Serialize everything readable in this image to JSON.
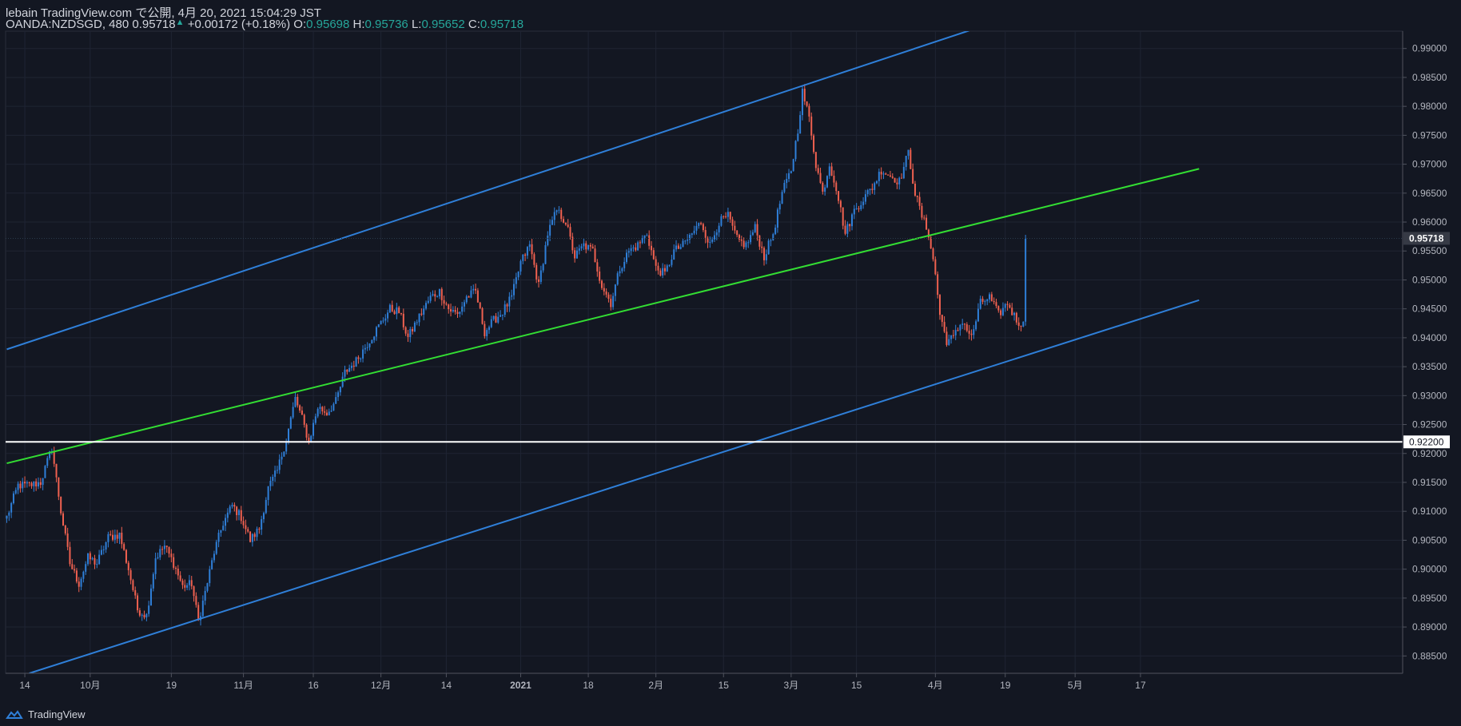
{
  "header": {
    "line1": "lebain TradingView.com で公開, 4月 20, 2021 15:04:29 JST",
    "symbol": "OANDA:NZDSGD, 480",
    "last": "0.95718",
    "change_arrow": "▲",
    "change": "+0.00172 (+0.18%)",
    "o_label": "O:",
    "o_value": "0.95698",
    "h_label": "H:",
    "h_value": "0.95736",
    "l_label": "L:",
    "l_value": "0.95652",
    "c_label": "C:",
    "c_value": "0.95718"
  },
  "footer": {
    "brand": "TradingView"
  },
  "colors": {
    "background": "#131722",
    "up": "#2f7fd8",
    "down": "#f06150",
    "channel": "#2f7fd8",
    "midline": "#33dd33",
    "hline": "#ffffff",
    "grid": "#1f2433"
  },
  "chart_data": {
    "type": "candlestick",
    "symbol": "OANDA:NZDSGD",
    "interval": "480",
    "ylim": [
      0.882,
      0.993
    ],
    "y_ticks": [
      "0.99000",
      "0.98500",
      "0.98000",
      "0.97500",
      "0.97000",
      "0.96500",
      "0.96000",
      "0.95500",
      "0.95000",
      "0.94500",
      "0.94000",
      "0.93500",
      "0.93000",
      "0.92500",
      "0.92000",
      "0.91500",
      "0.91000",
      "0.90500",
      "0.90000",
      "0.89500",
      "0.89000",
      "0.88500"
    ],
    "x_ticks": [
      {
        "label": "14",
        "date": "2020-09-14",
        "bar": 8
      },
      {
        "label": "10月",
        "date": "2020-10-01",
        "bar": 37
      },
      {
        "label": "19",
        "date": "2020-10-19",
        "bar": 73
      },
      {
        "label": "11月",
        "date": "2020-11-01",
        "bar": 105
      },
      {
        "label": "16",
        "date": "2020-11-16",
        "bar": 136
      },
      {
        "label": "12月",
        "date": "2020-12-01",
        "bar": 166
      },
      {
        "label": "14",
        "date": "2020-12-14",
        "bar": 195
      },
      {
        "label": "2021",
        "date": "2021-01-01",
        "bar": 228
      },
      {
        "label": "18",
        "date": "2021-01-18",
        "bar": 258
      },
      {
        "label": "2月",
        "date": "2021-02-01",
        "bar": 288
      },
      {
        "label": "15",
        "date": "2021-02-15",
        "bar": 318
      },
      {
        "label": "3月",
        "date": "2021-03-01",
        "bar": 348
      },
      {
        "label": "15",
        "date": "2021-03-15",
        "bar": 377
      },
      {
        "label": "4月",
        "date": "2021-04-01",
        "bar": 412
      },
      {
        "label": "19",
        "date": "2021-04-19",
        "bar": 443
      },
      {
        "label": "5月",
        "date": "2021-05-01",
        "bar": 474
      },
      {
        "label": "17",
        "date": "2021-05-17",
        "bar": 503
      }
    ],
    "last_bar": 452,
    "last_price": "0.95718",
    "horizontal_line": {
      "price": 0.922,
      "label": "0.92200"
    },
    "trend_lines": [
      {
        "name": "upper-channel",
        "p1": {
          "bar": 0,
          "price": 0.938
        },
        "p2": {
          "bar": 427,
          "price": 0.9931
        }
      },
      {
        "name": "middle-line",
        "p1": {
          "bar": 0,
          "price": 0.9183
        },
        "p2": {
          "bar": 529,
          "price": 0.9692
        }
      },
      {
        "name": "lower-channel",
        "p1": {
          "bar": 10,
          "price": 0.882
        },
        "p2": {
          "bar": 529,
          "price": 0.9465
        }
      }
    ],
    "key_points": [
      [
        0,
        0.909
      ],
      [
        5,
        0.9145
      ],
      [
        10,
        0.9145
      ],
      [
        15,
        0.915
      ],
      [
        20,
        0.921
      ],
      [
        24,
        0.91
      ],
      [
        28,
        0.901
      ],
      [
        32,
        0.8975
      ],
      [
        36,
        0.902
      ],
      [
        40,
        0.901
      ],
      [
        45,
        0.9055
      ],
      [
        50,
        0.906
      ],
      [
        54,
        0.9
      ],
      [
        58,
        0.893
      ],
      [
        62,
        0.892
      ],
      [
        66,
        0.902
      ],
      [
        70,
        0.904
      ],
      [
        74,
        0.901
      ],
      [
        78,
        0.897
      ],
      [
        82,
        0.8975
      ],
      [
        85,
        0.891
      ],
      [
        88,
        0.896
      ],
      [
        92,
        0.903
      ],
      [
        96,
        0.908
      ],
      [
        100,
        0.911
      ],
      [
        104,
        0.909
      ],
      [
        108,
        0.905
      ],
      [
        112,
        0.907
      ],
      [
        116,
        0.914
      ],
      [
        120,
        0.917
      ],
      [
        124,
        0.9225
      ],
      [
        128,
        0.9295
      ],
      [
        131,
        0.926
      ],
      [
        134,
        0.922
      ],
      [
        138,
        0.928
      ],
      [
        142,
        0.927
      ],
      [
        146,
        0.929
      ],
      [
        150,
        0.934
      ],
      [
        155,
        0.936
      ],
      [
        160,
        0.939
      ],
      [
        165,
        0.942
      ],
      [
        170,
        0.945
      ],
      [
        174,
        0.9445
      ],
      [
        178,
        0.94
      ],
      [
        182,
        0.943
      ],
      [
        188,
        0.947
      ],
      [
        192,
        0.948
      ],
      [
        196,
        0.945
      ],
      [
        200,
        0.944
      ],
      [
        204,
        0.947
      ],
      [
        208,
        0.948
      ],
      [
        212,
        0.941
      ],
      [
        216,
        0.943
      ],
      [
        220,
        0.9445
      ],
      [
        224,
        0.947
      ],
      [
        228,
        0.953
      ],
      [
        232,
        0.956
      ],
      [
        236,
        0.949
      ],
      [
        240,
        0.958
      ],
      [
        244,
        0.962
      ],
      [
        248,
        0.96
      ],
      [
        252,
        0.954
      ],
      [
        256,
        0.956
      ],
      [
        260,
        0.955
      ],
      [
        264,
        0.949
      ],
      [
        268,
        0.946
      ],
      [
        272,
        0.952
      ],
      [
        276,
        0.955
      ],
      [
        280,
        0.956
      ],
      [
        284,
        0.958
      ],
      [
        288,
        0.952
      ],
      [
        292,
        0.951
      ],
      [
        296,
        0.955
      ],
      [
        300,
        0.956
      ],
      [
        304,
        0.958
      ],
      [
        308,
        0.96
      ],
      [
        312,
        0.956
      ],
      [
        316,
        0.96
      ],
      [
        320,
        0.961
      ],
      [
        324,
        0.957
      ],
      [
        328,
        0.956
      ],
      [
        332,
        0.959
      ],
      [
        336,
        0.954
      ],
      [
        340,
        0.958
      ],
      [
        344,
        0.965
      ],
      [
        348,
        0.969
      ],
      [
        351,
        0.976
      ],
      [
        353,
        0.9825
      ],
      [
        356,
        0.978
      ],
      [
        359,
        0.97
      ],
      [
        362,
        0.965
      ],
      [
        365,
        0.97
      ],
      [
        368,
        0.966
      ],
      [
        372,
        0.958
      ],
      [
        376,
        0.962
      ],
      [
        380,
        0.964
      ],
      [
        384,
        0.966
      ],
      [
        388,
        0.969
      ],
      [
        392,
        0.968
      ],
      [
        396,
        0.967
      ],
      [
        400,
        0.972
      ],
      [
        403,
        0.965
      ],
      [
        406,
        0.961
      ],
      [
        409,
        0.958
      ],
      [
        412,
        0.951
      ],
      [
        414,
        0.944
      ],
      [
        417,
        0.9395
      ],
      [
        420,
        0.94
      ],
      [
        424,
        0.943
      ],
      [
        428,
        0.94
      ],
      [
        432,
        0.946
      ],
      [
        436,
        0.947
      ],
      [
        440,
        0.944
      ],
      [
        444,
        0.946
      ],
      [
        448,
        0.943
      ],
      [
        452,
        0.942
      ],
      [
        454,
        0.949
      ],
      [
        456,
        0.955
      ],
      [
        458,
        0.957
      ],
      [
        461,
        0.954
      ],
      [
        464,
        0.956
      ],
      [
        466,
        0.9572
      ]
    ]
  }
}
